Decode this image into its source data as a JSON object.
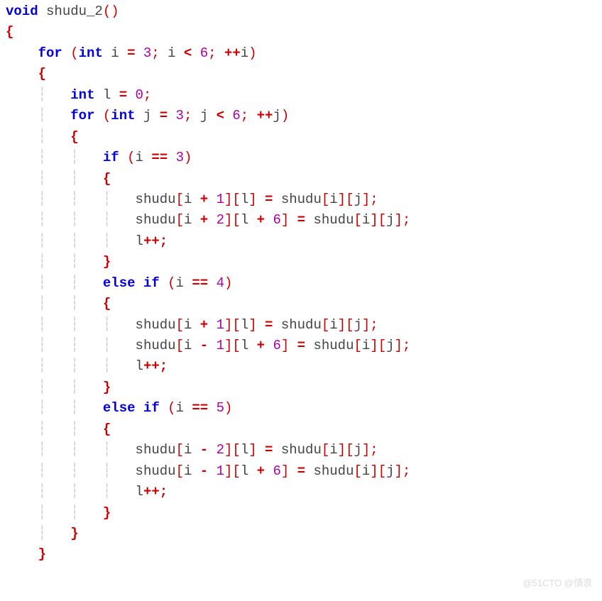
{
  "watermark": "@51CTO @憒浪",
  "tokens": {
    "kw_void": "void",
    "kw_int": "int",
    "kw_for": "for",
    "kw_if": "if",
    "kw_else": "else",
    "id_fn": "shudu_2",
    "id_i": "i",
    "id_j": "j",
    "id_l": "l",
    "id_arr": "shudu",
    "n0": "0",
    "n1": "1",
    "n2": "2",
    "n3": "3",
    "n4": "4",
    "n5": "5",
    "n6": "6"
  },
  "indent": {
    "s2": "  ",
    "s4": "    ",
    "s6": "      ",
    "s8": "        "
  },
  "source": "void shudu_2()\n{\n    for (int i = 3; i < 6; ++i)\n    {\n        int l = 0;\n        for (int j = 3; j < 6; ++j)\n        {\n            if (i == 3)\n            {\n                shudu[i + 1][l] = shudu[i][j];\n                shudu[i + 2][l + 6] = shudu[i][j];\n                l++;\n            }\n            else if (i == 4)\n            {\n                shudu[i + 1][l] = shudu[i][j];\n                shudu[i - 1][l + 6] = shudu[i][j];\n                l++;\n            }\n            else if (i == 5)\n            {\n                shudu[i - 2][l] = shudu[i][j];\n                shudu[i - 1][l + 6] = shudu[i][j];\n                l++;\n            }\n        }\n    }"
}
